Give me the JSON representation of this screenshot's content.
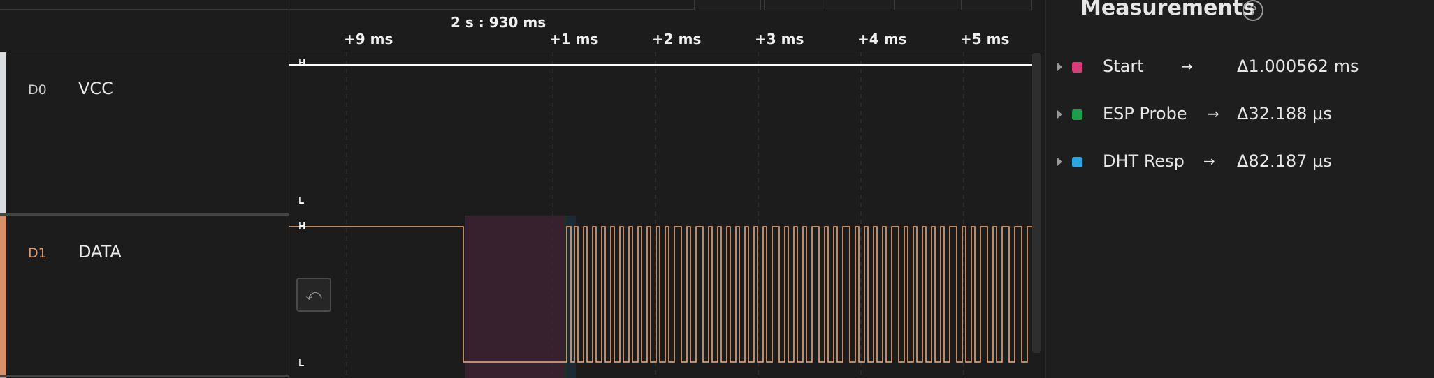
{
  "timeline": {
    "reference_label": "2 s : 930 ms",
    "ticks": [
      "+9 ms",
      "+1 ms",
      "+2 ms",
      "+3 ms",
      "+4 ms",
      "+5 ms"
    ]
  },
  "channels": [
    {
      "id": "D0",
      "name": "VCC",
      "color": "#d9dde0",
      "id_color": "#cfcfcf",
      "trace_color": "#ffffff",
      "high": "H",
      "low": "L"
    },
    {
      "id": "D1",
      "name": "DATA",
      "color": "#d8906a",
      "id_color": "#e09a70",
      "trace_color": "#f0b080",
      "high": "H",
      "low": "L"
    }
  ],
  "measurements": {
    "title": "Measurements",
    "help": "?",
    "items": [
      {
        "name": "Start",
        "arrow": "→",
        "value": "Δ1.000562 ms",
        "color": "#d63d7a"
      },
      {
        "name": "ESP Probe",
        "arrow": "→",
        "value": "Δ32.188 μs",
        "color": "#1f9e4a"
      },
      {
        "name": "DHT Resp",
        "arrow": "→",
        "value": "Δ82.187 μs",
        "color": "#2aa6e0"
      }
    ]
  },
  "icons": {
    "undo": "undo-icon",
    "help": "help-circle-icon",
    "expand": "caret-right-icon"
  }
}
